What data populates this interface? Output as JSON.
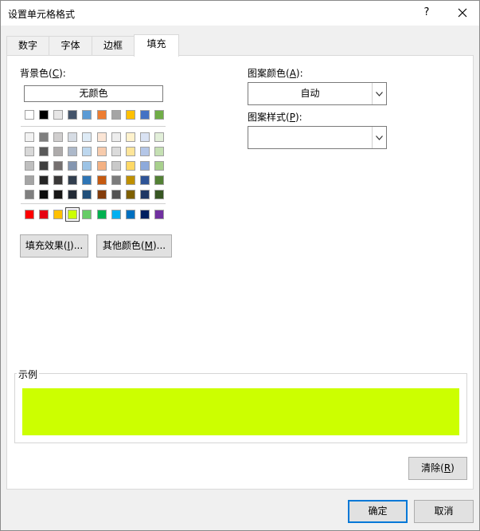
{
  "window": {
    "title": "设置单元格格式",
    "help_glyph": "?",
    "close_glyph": "✕"
  },
  "tabs": [
    {
      "label": "数字"
    },
    {
      "label": "字体"
    },
    {
      "label": "边框"
    },
    {
      "label": "填充"
    }
  ],
  "active_tab": "填充",
  "fill": {
    "background_label": "背景色(",
    "background_key": "C",
    "background_suffix": "):",
    "no_color_label": "无颜色",
    "selected_color": "#ccff00",
    "theme_colors": [
      "#ffffff",
      "#000000",
      "#e7e6e6",
      "#44546a",
      "#5b9bd5",
      "#ed7d31",
      "#a5a5a5",
      "#ffc000",
      "#4472c4",
      "#70ad47"
    ],
    "tint_rows": [
      [
        "#f2f2f2",
        "#7f7f7f",
        "#d0cece",
        "#d6dce4",
        "#deebf6",
        "#fbe5d5",
        "#ededed",
        "#fff2cc",
        "#d9e2f3",
        "#e2efd9"
      ],
      [
        "#d8d8d8",
        "#595959",
        "#aeabab",
        "#adb9ca",
        "#bdd7ee",
        "#f7cbac",
        "#dbdbdb",
        "#fee599",
        "#b4c6e7",
        "#c5e0b3"
      ],
      [
        "#bfbfbf",
        "#3f3f3f",
        "#757070",
        "#8496b0",
        "#9cc3e5",
        "#f4b183",
        "#c9c9c9",
        "#ffd965",
        "#8eaadb",
        "#a8d08d"
      ],
      [
        "#a5a5a5",
        "#262626",
        "#3a3838",
        "#323f4f",
        "#2e75b5",
        "#c55a11",
        "#7b7b7b",
        "#bf9000",
        "#2f5496",
        "#538135"
      ],
      [
        "#7f7f7f",
        "#0c0c0c",
        "#171616",
        "#222a35",
        "#1f4e79",
        "#833c0b",
        "#525252",
        "#7f6000",
        "#1f3864",
        "#375623"
      ]
    ],
    "standard_colors": [
      "#ff0000",
      "#e60012",
      "#ffc000",
      "#ccff00",
      "#66cc66",
      "#00b050",
      "#00b0f0",
      "#0070c0",
      "#002060",
      "#7030a0"
    ],
    "fill_effects_button": {
      "prefix": "填充效果(",
      "key": "I",
      "suffix": ")..."
    },
    "more_colors_button": {
      "prefix": "其他颜色(",
      "key": "M",
      "suffix": ")..."
    },
    "pattern_color_label": {
      "prefix": "图案颜色(",
      "key": "A",
      "suffix": "):"
    },
    "pattern_color_value": "自动",
    "pattern_style_label": {
      "prefix": "图案样式(",
      "key": "P",
      "suffix": "):"
    },
    "pattern_style_value": "",
    "sample_label": "示例",
    "clear_button": {
      "prefix": "清除(",
      "key": "R",
      "suffix": ")"
    }
  },
  "footer": {
    "ok_label": "确定",
    "cancel_label": "取消"
  }
}
